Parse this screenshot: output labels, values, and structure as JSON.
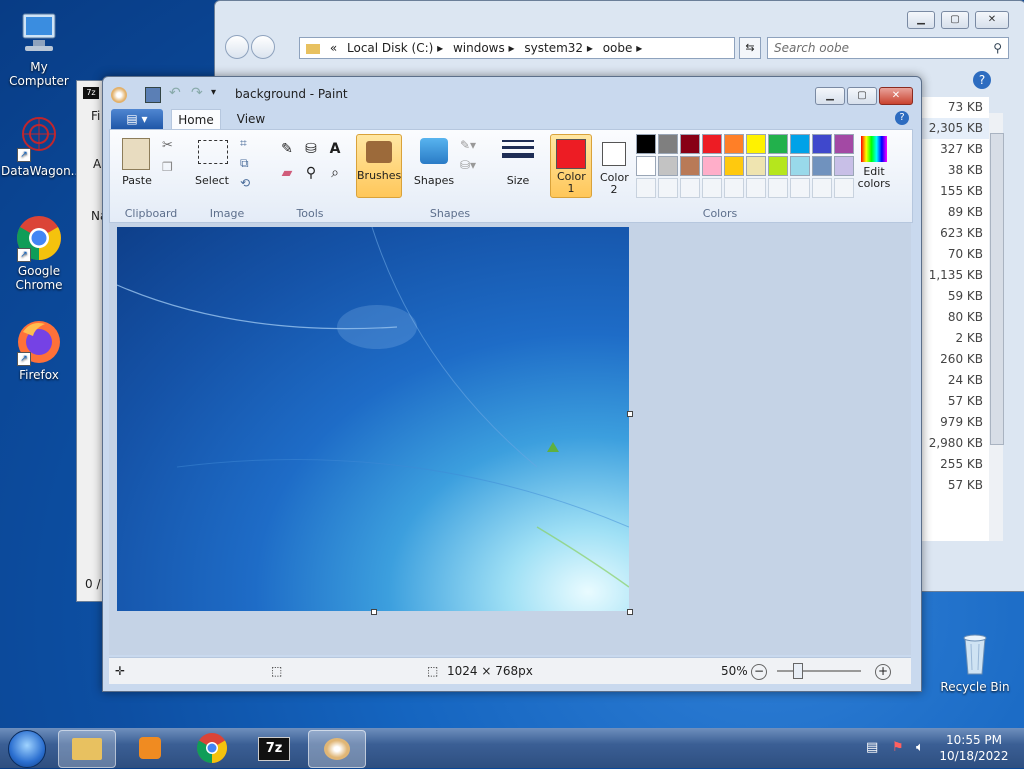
{
  "desktop": {
    "icons": [
      {
        "label": "My Computer"
      },
      {
        "label": "DataWagon..."
      },
      {
        "label": "Google Chrome"
      },
      {
        "label": "Firefox"
      },
      {
        "label": "Recycle Bin"
      }
    ]
  },
  "explorer": {
    "breadcrumb_prefix": "«",
    "path": [
      "Local Disk (C:)",
      "windows",
      "system32",
      "oobe"
    ],
    "search_placeholder": "Search oobe",
    "sizes": [
      "73 KB",
      "2,305 KB",
      "327 KB",
      "38 KB",
      "155 KB",
      "89 KB",
      "623 KB",
      "70 KB",
      "1,135 KB",
      "59 KB",
      "80 KB",
      "2 KB",
      "260 KB",
      "24 KB",
      "57 KB",
      "979 KB",
      "2,980 KB",
      "255 KB",
      "57 KB"
    ]
  },
  "sevenzip": {
    "partial_labels": [
      "Fi",
      "A",
      "Na",
      "0 /"
    ]
  },
  "paint": {
    "title": "background - Paint",
    "tabs": [
      "Home",
      "View"
    ],
    "groups": {
      "clipboard": "Clipboard",
      "image": "Image",
      "tools": "Tools",
      "shapes": "Shapes",
      "colors": "Colors"
    },
    "buttons": {
      "paste": "Paste",
      "select": "Select",
      "brushes": "Brushes",
      "shapes": "Shapes",
      "size": "Size",
      "color1": "Color 1",
      "color2": "Color 2",
      "edit_colors": "Edit colors"
    },
    "palette_row1": [
      "#000000",
      "#7f7f7f",
      "#880015",
      "#ed1c24",
      "#ff7f27",
      "#fff200",
      "#22b14c",
      "#00a2e8",
      "#3f48cc",
      "#a349a4"
    ],
    "palette_row2": [
      "#ffffff",
      "#c3c3c3",
      "#b97a57",
      "#ffaec9",
      "#ffc90e",
      "#efe4b0",
      "#b5e61d",
      "#99d9ea",
      "#7092be",
      "#c8bfe7"
    ],
    "color1": "#ed1c24",
    "color2": "#ffffff",
    "status": {
      "dimensions": "1024 × 768px",
      "zoom": "50%"
    }
  },
  "taskbar": {
    "time": "10:55 PM",
    "date": "10/18/2022"
  }
}
